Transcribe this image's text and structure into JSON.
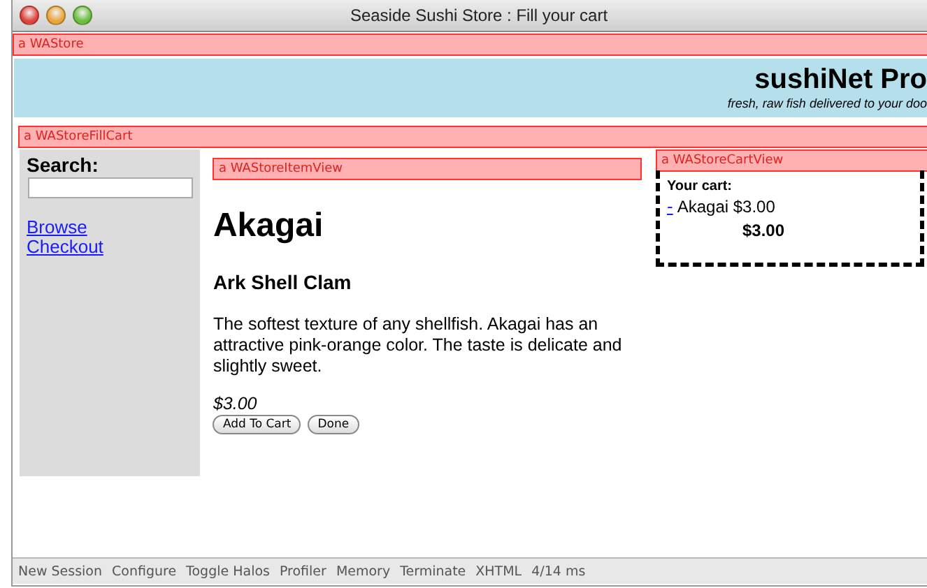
{
  "window": {
    "title": "Seaside Sushi Store : Fill your cart"
  },
  "store_halo": {
    "label": "a WAStore"
  },
  "header": {
    "title": "sushiNet Pro",
    "tagline": "fresh, raw fish delivered to your doo"
  },
  "fill_cart_halo": {
    "label": "a WAStoreFillCart"
  },
  "sidebar": {
    "search_label": "Search:",
    "links": [
      "Browse",
      "Checkout"
    ]
  },
  "item_halo": {
    "label": "a WAStoreItemView"
  },
  "item": {
    "name": "Akagai",
    "subtitle": "Ark Shell Clam",
    "description": "The softest texture of any shellfish. Akagai has an attractive pink-orange color. The taste is delicate and slightly sweet.",
    "price": "$3.00",
    "buttons": [
      "Add To Cart",
      "Done"
    ]
  },
  "cart_halo": {
    "label": "a WAStoreCartView"
  },
  "cart": {
    "title": "Your cart:",
    "items": [
      {
        "remove": "-",
        "text": "Akagai $3.00"
      }
    ],
    "total": "$3.00"
  },
  "status_bar": [
    "New Session",
    "Configure",
    "Toggle Halos",
    "Profiler",
    "Memory",
    "Terminate",
    "XHTML",
    "4/14 ms"
  ]
}
